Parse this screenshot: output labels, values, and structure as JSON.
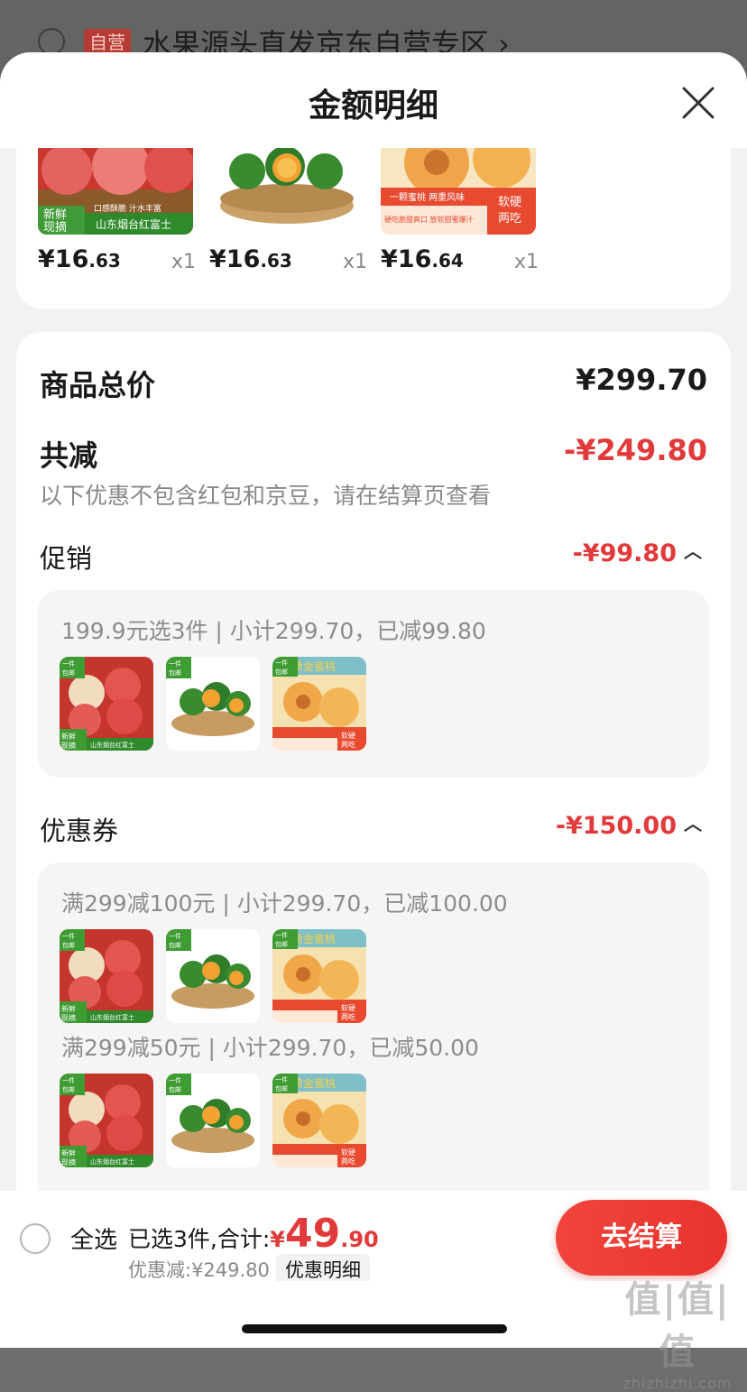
{
  "background": {
    "store_tag": "自营",
    "store_text": "水果源头直发京东自营专区 ›"
  },
  "sheet": {
    "title": "金额明细"
  },
  "products": [
    {
      "price_int": "¥16",
      "price_dec": ".63",
      "qty": "x1",
      "labels": [
        "新鲜",
        "现摘",
        "口感酥脆 汁水丰富",
        "山东烟台红富士"
      ]
    },
    {
      "price_int": "¥16",
      "price_dec": ".63",
      "qty": "x1",
      "labels": []
    },
    {
      "price_int": "¥16",
      "price_dec": ".64",
      "qty": "x1",
      "labels": [
        "一颗蜜桃 两重风味",
        "硬吃脆甜爽口 放软甜蜜爆汁",
        "软硬",
        "两吃"
      ]
    }
  ],
  "summary": {
    "total_label": "商品总价",
    "total_value": "¥299.70",
    "reduce_label": "共减",
    "reduce_value": "-¥249.80",
    "note": "以下优惠不包含红包和京豆，请在结算页查看"
  },
  "promo": {
    "label": "促销",
    "value": "-¥99.80",
    "rule": "199.9元选3件 | 小计299.70，已减99.80"
  },
  "coupon": {
    "label": "优惠券",
    "value": "-¥150.00",
    "rules": [
      "满299减100元 | 小计299.70，已减100.00",
      "满299减50元 | 小计299.70，已减50.00"
    ]
  },
  "thumb_labels": {
    "apple_badge": "一件\n包邮",
    "apple_corner": "新鲜\n现摘",
    "apple_bar": "山东烟台红富士",
    "peach_banner": "黄金蜜桃",
    "peach_corner": "软硬\n两吃"
  },
  "bottom": {
    "select_all": "全选",
    "selected": "已选3件,合计:",
    "total_symbol": "¥",
    "total_int": "49",
    "total_dec": ".90",
    "discount": "优惠减:¥249.80",
    "detail": "优惠明细",
    "checkout": "去结算"
  },
  "watermark": {
    "main": "值|值|值",
    "sub": "zhizhizhi.com"
  },
  "colors": {
    "accent": "#e2393a",
    "checkout_bg": "#ef4239"
  }
}
